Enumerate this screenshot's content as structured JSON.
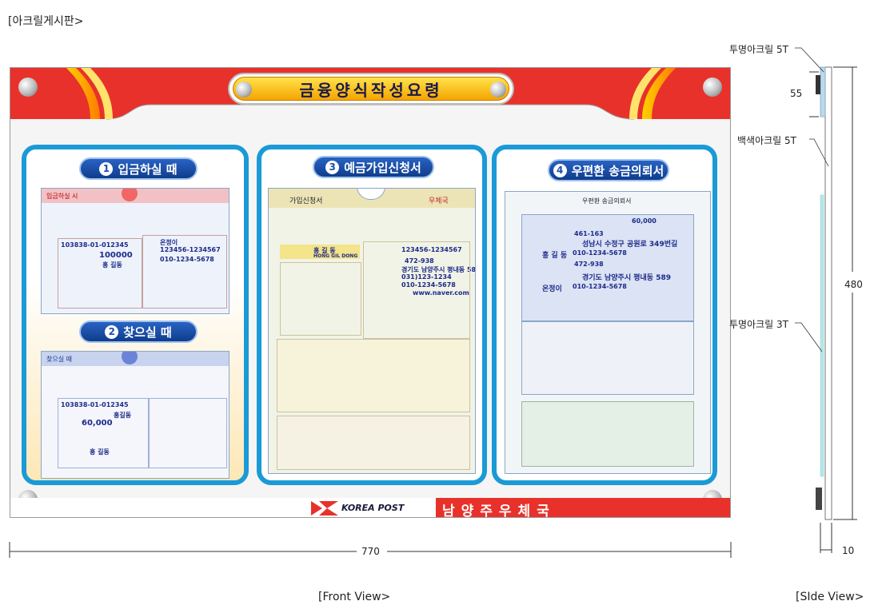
{
  "page": {
    "title": "[아크릴게시판>",
    "front_view": "[Front View>",
    "side_view": "[SIde View>"
  },
  "board": {
    "heading": "금융양식작성요령",
    "footer_logo": "KOREA POST",
    "footer_office": "남양주우체국",
    "accent_red": "#e8312a",
    "accent_blue": "#1a9ad6"
  },
  "panels": [
    {
      "num": "1",
      "title": "입금하실 때"
    },
    {
      "num": "2",
      "title": "찾으실 때"
    },
    {
      "num": "3",
      "title": "예금가입신청서"
    },
    {
      "num": "4",
      "title": "우편환 송금의뢰서"
    }
  ],
  "forms": {
    "deposit": {
      "header": "입금하실 시",
      "account": "103838-01-012345",
      "amount": "100000",
      "name": "홍 길동",
      "recipient": "온정이",
      "acc2": "123456-1234567",
      "phone": "010-1234-5678"
    },
    "withdraw": {
      "header": "찾으실 때",
      "account": "103838-01-012345",
      "name": "홍길동",
      "amount": "60,000",
      "signer": "홍 길동"
    },
    "signup": {
      "header": "가입신청서",
      "brand": "우체국",
      "name": "홍 길 동",
      "name_en": "HONG GIL DONG",
      "rrn": "123456-1234567",
      "zip": "472-938",
      "address": "경기도 남양주시 평내동 589",
      "tel": "031)123-1234",
      "mobile": "010-1234-5678",
      "web": "www.naver.com"
    },
    "remit": {
      "header": "우편환 송금의뢰서",
      "amount": "60,000",
      "sender_zip": "461-163",
      "sender_addr": "성남시 수정구 공원로 349번길",
      "sender": "홍 길 동",
      "sender_phone": "010-1234-5678",
      "recv_zip": "472-938",
      "recv_addr": "경기도 남양주시 평내동 589",
      "recv": "온정이",
      "recv_phone": "010-1234-5678"
    }
  },
  "dimensions": {
    "width": "770",
    "height": "480",
    "top": "55",
    "thickness": "10"
  },
  "labels": {
    "clear_5t": "투명아크릴 5T",
    "white_5t": "백색아크릴 5T",
    "clear_3t": "투명아크릴 3T"
  }
}
